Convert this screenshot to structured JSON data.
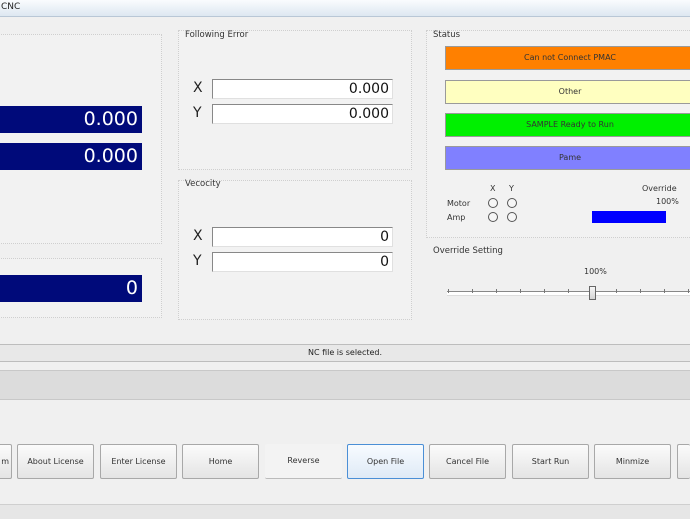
{
  "window": {
    "title": "CNC"
  },
  "left": {
    "values": [
      "0.000",
      "0.000"
    ],
    "counter": "0"
  },
  "following_error": {
    "label": "Following Error",
    "rows": [
      {
        "axis": "X",
        "value": "0.000"
      },
      {
        "axis": "Y",
        "value": "0.000"
      }
    ]
  },
  "velocity": {
    "label": "Vecocity",
    "rows": [
      {
        "axis": "X",
        "value": "0"
      },
      {
        "axis": "Y",
        "value": "0"
      }
    ]
  },
  "status": {
    "label": "Status",
    "boxes": [
      {
        "text": "Can not Connect PMAC",
        "color": "#ff8000"
      },
      {
        "text": "Other",
        "color": "#ffffc0"
      },
      {
        "text": "SAMPLE Ready to Run",
        "color": "#00f000"
      },
      {
        "text": "Pame",
        "color": "#8080ff"
      }
    ],
    "axes_x": "X",
    "axes_y": "Y",
    "motor": "Motor",
    "amp": "Amp",
    "override_label": "Override",
    "override_value": "100%",
    "override_fraction": 1.0
  },
  "override_setting": {
    "label": "Override Setting",
    "value": "100%"
  },
  "statusbar": {
    "message": "NC file is selected."
  },
  "buttons": [
    {
      "label": "m"
    },
    {
      "label": "About License"
    },
    {
      "label": "Enter License"
    },
    {
      "label": "Home"
    },
    {
      "label": "Reverse"
    },
    {
      "label": "Open File"
    },
    {
      "label": "Cancel File"
    },
    {
      "label": "Start Run"
    },
    {
      "label": "Minmize"
    },
    {
      "label": ""
    }
  ],
  "colors": {
    "accent_blue": "#000a7a",
    "override_bar": "#0000ff"
  }
}
